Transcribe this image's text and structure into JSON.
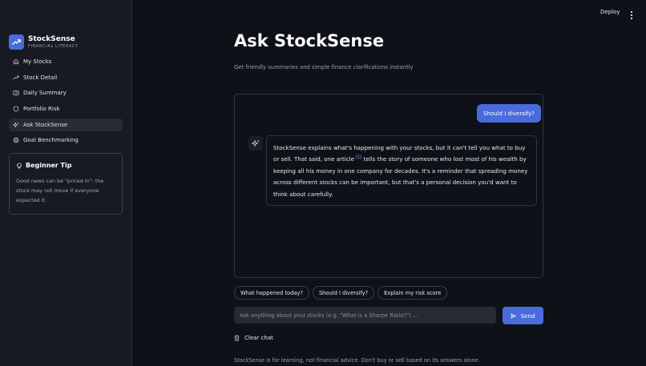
{
  "brand": {
    "name": "StockSense",
    "tagline": "FINANCIAL LITERACY"
  },
  "sidebar": {
    "items": [
      {
        "label": "My Stocks",
        "icon": "home-icon"
      },
      {
        "label": "Stock Detail",
        "icon": "trend-line-icon"
      },
      {
        "label": "Daily Summary",
        "icon": "newspaper-icon"
      },
      {
        "label": "Portfolio Risk",
        "icon": "shield-icon"
      },
      {
        "label": "Ask StockSense",
        "icon": "sparkles-icon",
        "active": true
      },
      {
        "label": "Goal Benchmarking",
        "icon": "target-icon"
      }
    ],
    "tip": {
      "title": "Beginner Tip",
      "body": "Good news can be \"priced in\": the stock may not move if everyone expected it."
    }
  },
  "header": {
    "deploy_label": "Deploy"
  },
  "main": {
    "title": "Ask StockSense",
    "subtitle": "Get friendly summaries and simple finance clarifications instantly",
    "chat": {
      "user_message": "Should I diversify?",
      "bot_text_before": "StockSense explains what's happening with your stocks, but it can't tell you what to buy or sell. That said, one article ",
      "bot_citation": "[1]",
      "bot_text_after": " tells the story of someone who lost most of his wealth by keeping all his money in one company for decades. It's a reminder that spreading money across different stocks can be important, but that's a personal decision you'd want to think about carefully."
    },
    "suggestions": [
      "What happened today?",
      "Should I diversify?",
      "Explain my risk score"
    ],
    "input": {
      "placeholder": "Ask anything about your stocks (e.g. \"What is a Sharpe Ratio?\") ...",
      "value": ""
    },
    "send_label": "Send",
    "clear_label": "Clear chat",
    "disclaimer": "StockSense is for learning, not financial advice. Don't buy or sell based on its answers alone."
  },
  "colors": {
    "background": "#0e1117",
    "sidebar": "#171a22",
    "accent": "#4a6bdc",
    "text": "#fafafa",
    "muted": "#9aa0ab"
  }
}
